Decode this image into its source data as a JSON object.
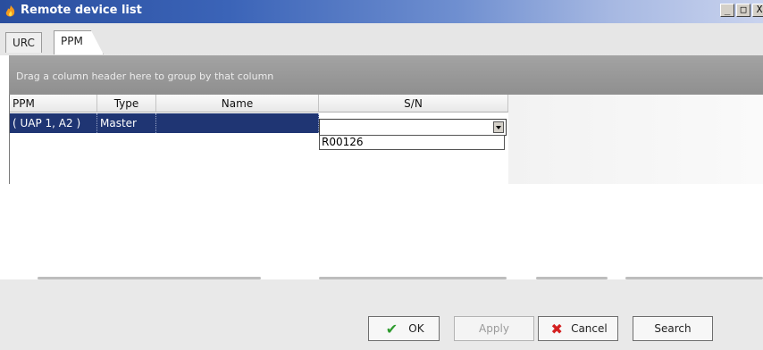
{
  "window": {
    "title": "Remote device list",
    "min_btn": "_",
    "max_btn": "□",
    "close_btn": "X"
  },
  "tabs": [
    {
      "label": "URC",
      "active": false
    },
    {
      "label": "PPM",
      "active": true
    }
  ],
  "group_panel": {
    "hint": "Drag a column header here to group by that column"
  },
  "grid": {
    "columns": [
      "PPM",
      "Type",
      "Name",
      "S/N"
    ],
    "rows": [
      {
        "ppm": "( UAP 1, A2 )",
        "type": "Master",
        "name": "",
        "sn": ""
      }
    ]
  },
  "sn_dropdown": {
    "value": "",
    "options": [
      "R00126"
    ]
  },
  "buttons": {
    "ok": "OK",
    "apply": "Apply",
    "cancel": "Cancel",
    "search": "Search"
  },
  "colors": {
    "selected_row": "#1f3573",
    "titlebar": "#2a4e9e",
    "ok_icon": "#2e9b2e",
    "cancel_icon": "#d42020"
  }
}
